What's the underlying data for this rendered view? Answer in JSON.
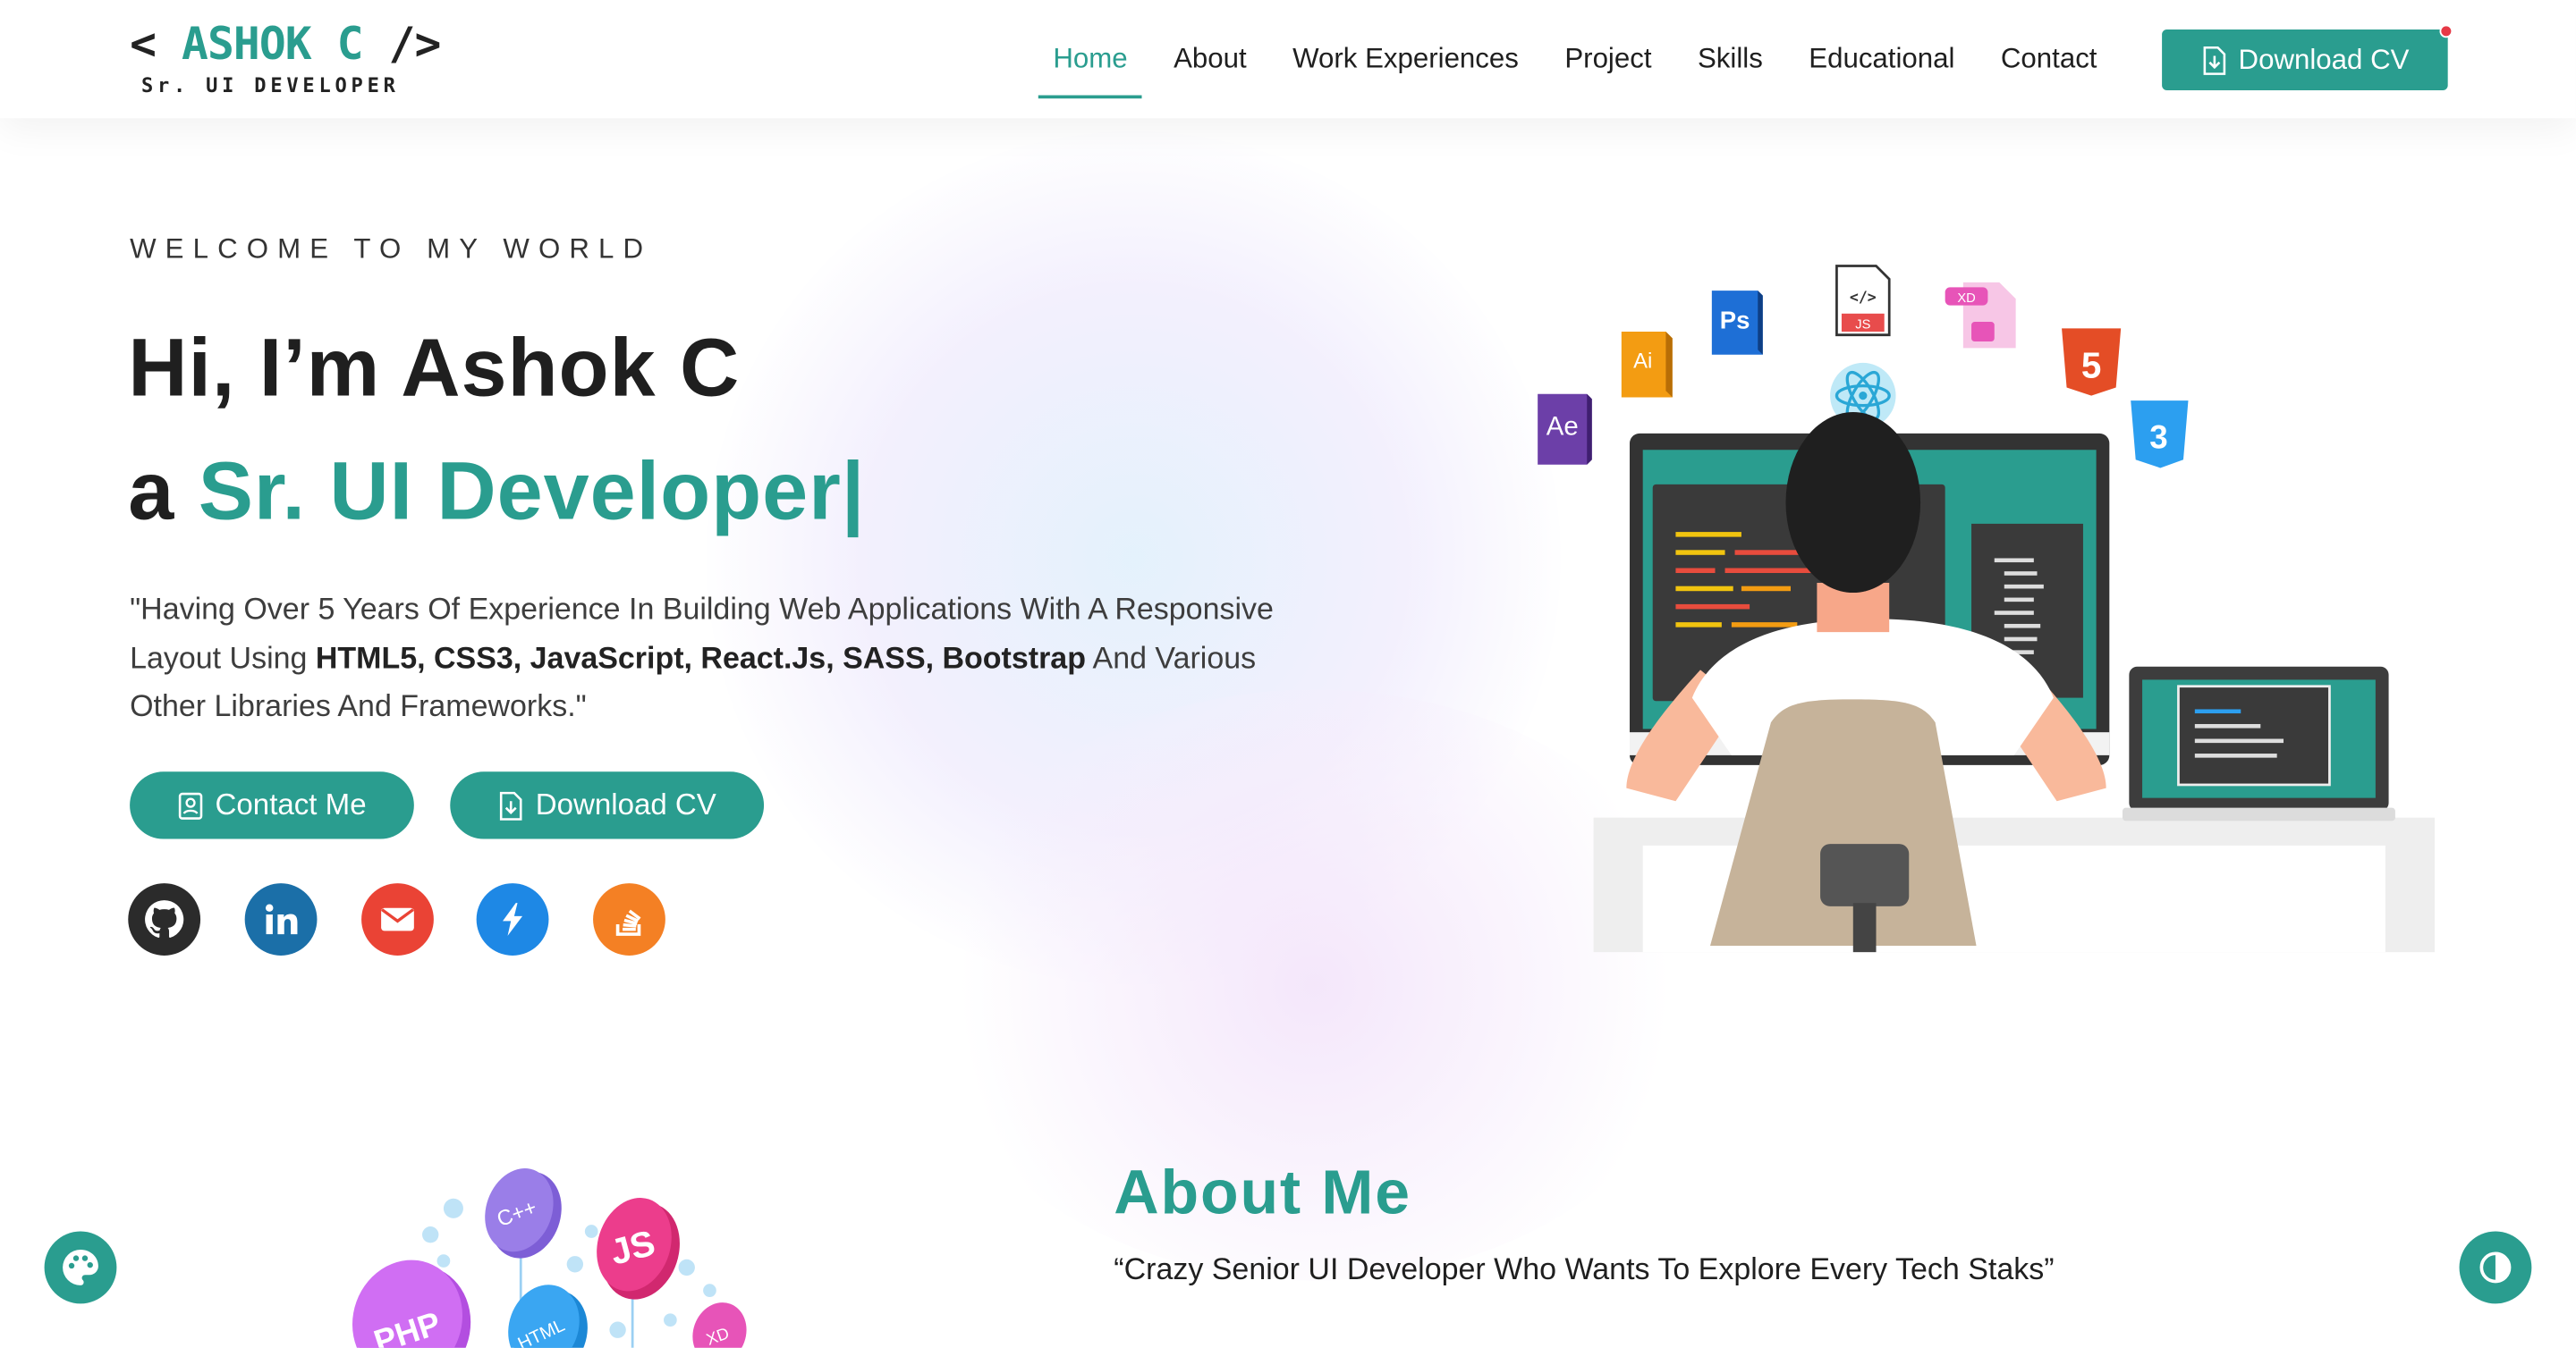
{
  "brand": {
    "name": "ASHOK C",
    "open_bracket": "<",
    "close_bracket": "/>",
    "subtitle": "Sr. UI DEVELOPER"
  },
  "nav": {
    "links": [
      "Home",
      "About",
      "Work Experiences",
      "Project",
      "Skills",
      "Educational",
      "Contact"
    ],
    "active": "Home",
    "cv_button": "Download CV"
  },
  "hero": {
    "welcome": "WELCOME TO MY WORLD",
    "greeting": "Hi, I’m Ashok C",
    "role_prefix": "a ",
    "role": "Sr. UI Developer|",
    "desc_part1": "\"Having Over 5 Years Of Experience In Building Web Applications With A Responsive Layout Using ",
    "desc_tech": "HTML5, CSS3, JavaScript, React.Js, SASS, Bootstrap",
    "desc_part2": " And Various Other Libraries And Frameworks.\"",
    "contact_button": "Contact Me",
    "cv_button": "Download CV"
  },
  "social_icons": [
    {
      "name": "github-icon",
      "color": "#2b2b2b"
    },
    {
      "name": "linkedin-icon",
      "color": "#1b6fa8"
    },
    {
      "name": "email-icon",
      "color": "#ea4335"
    },
    {
      "name": "bolt-icon",
      "color": "#1e88e5"
    },
    {
      "name": "stackoverflow-icon",
      "color": "#f48024"
    }
  ],
  "illustration_badges": {
    "ae": "Ae",
    "ai": "Ai",
    "ps": "Ps",
    "js_file": "JS",
    "js_tag": "</>",
    "xd": "XD",
    "html5": "5",
    "css3": "3"
  },
  "about": {
    "title": "About Me",
    "quote": "“Crazy Senior UI Developer Who Wants To Explore Every Tech Staks”",
    "bubbles": [
      "C++",
      "JS",
      "PHP",
      "HTML",
      "XD"
    ]
  },
  "colors": {
    "accent": "#2a9d8f",
    "text": "#1f1f1f",
    "notif": "#e63946"
  },
  "floating": {
    "left": "palette-icon",
    "right": "contrast-icon"
  }
}
